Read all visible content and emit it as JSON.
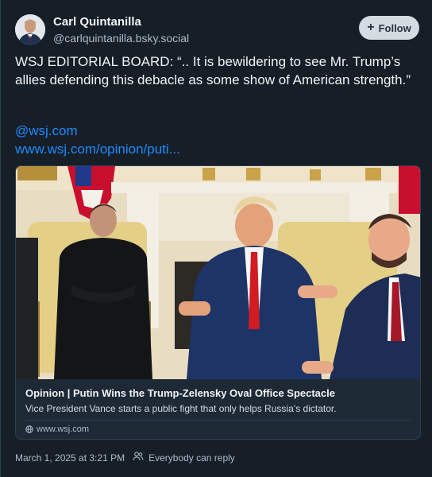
{
  "author": {
    "display_name": "Carl Quintanilla",
    "handle": "@carlquintanilla.bsky.social",
    "avatar_icon": "person-avatar"
  },
  "follow_button": {
    "label": "Follow",
    "icon": "plus-icon"
  },
  "post": {
    "text": "WSJ EDITORIAL BOARD: “.. It is bewildering to see Mr. Trump’s allies defending this debacle as some show of American strength.”",
    "links": [
      "@wsj.com",
      "www.wsj.com/opinion/puti..."
    ]
  },
  "link_card": {
    "image_alt": "Oval Office meeting photo",
    "title": "Opinion | Putin Wins the Trump-Zelensky Oval Office Spectacle",
    "description": "Vice President Vance starts a public fight that only helps Russia’s dictator.",
    "domain": "www.wsj.com",
    "domain_icon": "globe-icon"
  },
  "meta": {
    "timestamp": "March 1, 2025 at 3:21 PM",
    "reply_setting": "Everybody can reply",
    "reply_icon": "people-icon"
  },
  "colors": {
    "background": "#161e27",
    "link": "#208bfe",
    "muted": "#aebbc9",
    "follow_bg": "#d4dbe2"
  }
}
